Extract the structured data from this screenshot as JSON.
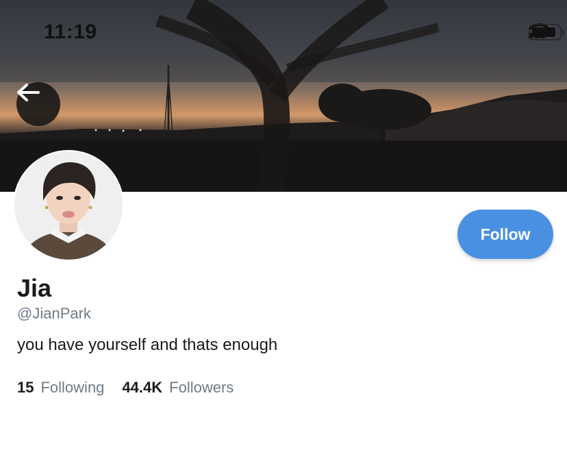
{
  "status_bar": {
    "time": "11:19",
    "signal_icon": "signal-bars-icon",
    "wifi_icon": "wifi-icon",
    "battery_icon": "battery-icon"
  },
  "header": {
    "back_icon": "arrow-left-icon"
  },
  "profile": {
    "display_name": "Jia",
    "handle": "@JianPark",
    "bio": "you have yourself and thats enough",
    "follow_label": "Follow",
    "following_count": "15",
    "following_label": "Following",
    "followers_count": "44.4K",
    "followers_label": "Followers"
  },
  "colors": {
    "accent": "#4a90e2",
    "muted_text": "#6f7a85",
    "primary_text": "#1a1a1a"
  }
}
